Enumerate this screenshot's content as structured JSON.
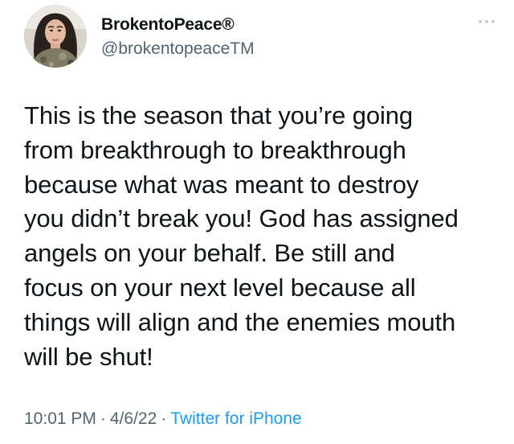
{
  "tweet": {
    "author": {
      "display_name": "BrokentoPeace®",
      "handle": "@brokentopeaceTM"
    },
    "text": "This is the season that you’re going\nfrom breakthrough to breakthrough\nbecause what was meant to destroy\nyou didn’t break you! God has assigned\nangels on your behalf. Be still and\nfocus on your next level because all\nthings will align and the enemies mouth\nwill be shut!",
    "time": "10:01 PM",
    "date": "4/6/22",
    "separator": "·",
    "source": "Twitter for iPhone"
  },
  "colors": {
    "text": "#0f1419",
    "secondary": "#536471",
    "link": "#1d9bf0",
    "more_icon": "#c5cdd3"
  },
  "icons": {
    "more": "more-dots-icon"
  }
}
